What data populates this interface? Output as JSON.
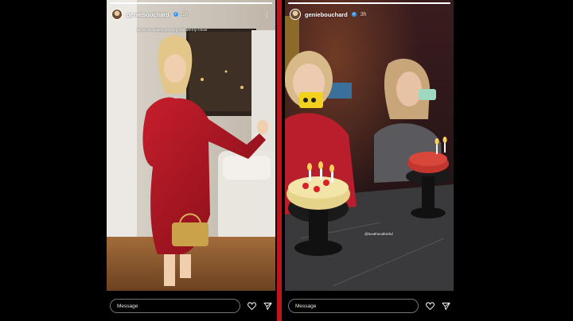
{
  "stories": [
    {
      "username": "geniebouchard",
      "time": "3h",
      "caption": "Bri-which-asleep-you-forgot-to-tell-my-Cheer",
      "reply_placeholder": "Message",
      "icons": [
        "more-icon",
        "heart-icon",
        "send-icon"
      ]
    },
    {
      "username": "geniebouchard",
      "time": "3h",
      "mention": "@bestfriendbirthd",
      "reply_placeholder": "Message",
      "icons": [
        "heart-icon",
        "send-icon"
      ]
    }
  ],
  "colors": {
    "divider": "#c0141c",
    "background": "#000000",
    "verified": "#3897f0"
  }
}
